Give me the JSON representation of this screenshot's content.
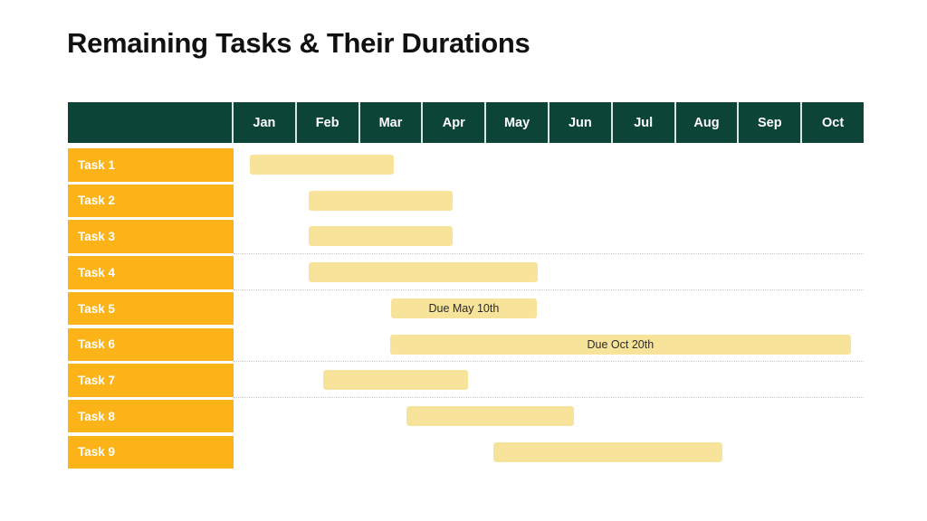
{
  "slide": {
    "title": "Remaining Tasks & Their Durations"
  },
  "colors": {
    "header_background": "#0d4438",
    "header_text": "#ffffff",
    "task_label_background": "#fbb317",
    "task_label_text": "#ffffff",
    "bar_fill": "#f7e399",
    "bar_text": "#2b2b2b",
    "gridline": "#c9c9cf",
    "page_background": "#ffffff",
    "title_text": "#111111"
  },
  "table": {
    "corner_label": "",
    "month_headers": [
      "Jan",
      "Feb",
      "Mar",
      "Apr",
      "May",
      "Jun",
      "Jul",
      "Aug",
      "Sep",
      "Oct"
    ]
  },
  "chart_data": {
    "type": "bar",
    "title": "Remaining Tasks & Their Durations",
    "xlabel": "",
    "ylabel": "",
    "orientation": "horizontal",
    "grid": "dotted-horizontal",
    "legend": "none",
    "categories": [
      "Jan",
      "Feb",
      "Mar",
      "Apr",
      "May",
      "Jun",
      "Jul",
      "Aug",
      "Sep",
      "Oct"
    ],
    "axis_unit": "month",
    "xlim": [
      0,
      10
    ],
    "tasks": [
      {
        "label": "Task 1",
        "start_month": 0.26,
        "end_month": 2.54,
        "duration_months": 2.28,
        "bar_label": ""
      },
      {
        "label": "Task 2",
        "start_month": 1.19,
        "end_month": 3.47,
        "duration_months": 2.28,
        "bar_label": ""
      },
      {
        "label": "Task 3",
        "start_month": 1.19,
        "end_month": 3.47,
        "duration_months": 2.28,
        "bar_label": ""
      },
      {
        "label": "Task 4",
        "start_month": 1.19,
        "end_month": 4.83,
        "duration_months": 3.64,
        "bar_label": ""
      },
      {
        "label": "Task 5",
        "start_month": 2.5,
        "end_month": 4.81,
        "duration_months": 2.31,
        "bar_label": "Due May 10th"
      },
      {
        "label": "Task 6",
        "start_month": 2.48,
        "end_month": 9.8,
        "duration_months": 7.32,
        "bar_label": "Due Oct 20th"
      },
      {
        "label": "Task 7",
        "start_month": 1.42,
        "end_month": 3.72,
        "duration_months": 2.3,
        "bar_label": ""
      },
      {
        "label": "Task 8",
        "start_month": 2.74,
        "end_month": 5.4,
        "duration_months": 2.66,
        "bar_label": ""
      },
      {
        "label": "Task 9",
        "start_month": 4.12,
        "end_month": 7.76,
        "duration_months": 3.64,
        "bar_label": ""
      }
    ]
  }
}
